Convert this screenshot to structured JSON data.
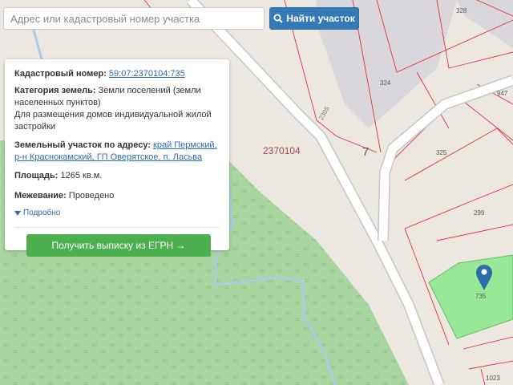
{
  "search": {
    "placeholder": "Адрес или кадастровый номер участка",
    "value": "",
    "button_label": "Найти участок",
    "button_icon": "search-icon"
  },
  "card": {
    "cadastral_label": "Кадастровый номер:",
    "cadastral_value": "59:07:2370104:735",
    "category_label": "Категория земель:",
    "category_value": "Земли поселений (земли населенных пунктов)",
    "purpose_value": "Для размещения домов индивидуальной жилой застройки",
    "address_label": "Земельный участок по адресу:",
    "address_value": "край Пермский, р-н Краснокамский, ГП Оверятское, п. Ласьва",
    "area_label": "Площадь:",
    "area_value": "1265 кв.м.",
    "survey_label": "Межевание:",
    "survey_value": "Проведено",
    "more_label": "Подробно",
    "more_icon": "triangle-down-icon",
    "egrn_button": "Получить выписку из ЕГРН →"
  },
  "map": {
    "quarter_label": "2370104",
    "zone_label": "7",
    "road_label": "2305",
    "plot_labels": [
      "328",
      "324",
      "947",
      "325",
      "299",
      "735",
      "1023"
    ],
    "marker_icon": "map-pin-icon",
    "colors": {
      "background": "#ece8e1",
      "forest": "#a8d5a0",
      "grey_zone": "#d9d7dc",
      "selected_plot": "#98e898",
      "boundary": "#dd3333",
      "road_fill": "#ffffff",
      "road_edge": "#c6c6c6",
      "stream": "#aecbe4",
      "marker": "#2e6ea8"
    }
  }
}
